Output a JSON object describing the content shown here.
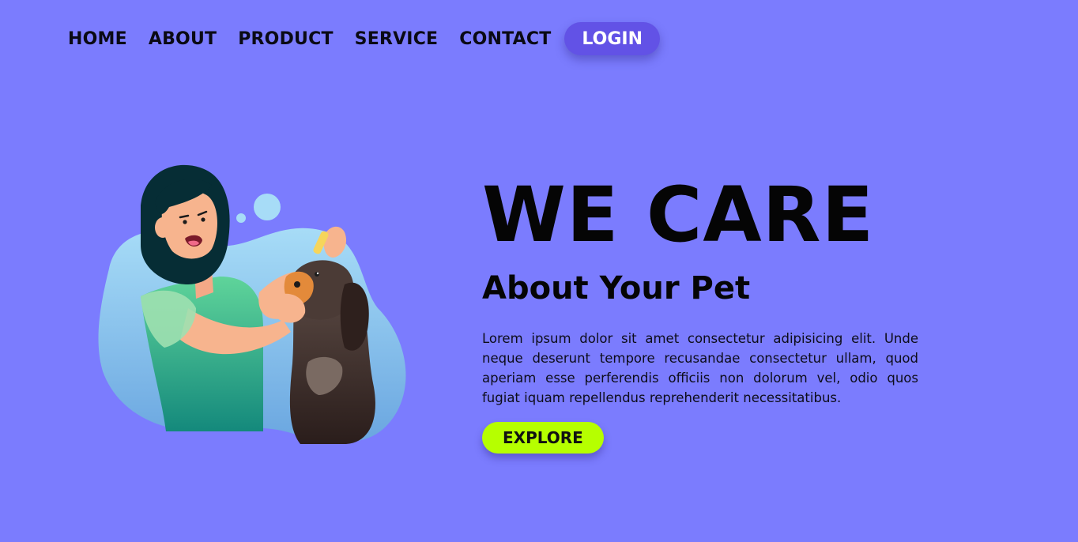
{
  "nav": {
    "items": [
      {
        "label": "HOME"
      },
      {
        "label": "ABOUT"
      },
      {
        "label": "PRODUCT"
      },
      {
        "label": "SERVICE"
      },
      {
        "label": "CONTACT"
      }
    ],
    "login_label": "LOGIN"
  },
  "hero": {
    "title": "WE CARE",
    "subtitle": "About Your Pet",
    "body": "Lorem ipsum dolor sit amet consectetur adipisicing elit. Unde neque deserunt tempore recusandae consectetur ullam, quod aperiam esse perferendis officiis non dolorum vel, odio quos fugiat iquam repellendus reprehenderit necessitatibus.",
    "cta_label": "EXPLORE"
  },
  "illustration": {
    "subject": "woman applying ear drops to a dog"
  },
  "colors": {
    "background": "#7b7cfe",
    "login_button": "#6252e6",
    "explore_button": "#b6ff00",
    "text": "#050505"
  }
}
